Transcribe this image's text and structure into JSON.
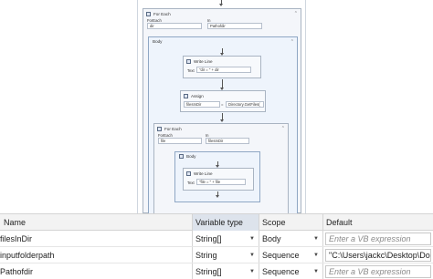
{
  "designer": {
    "outer_foreach": {
      "title": "For Each",
      "foreach_label": "ForEach",
      "in_label": "In",
      "item_value": "dir",
      "collection_value": "Pathofdir",
      "body": {
        "title": "Body",
        "writeline1": {
          "title": "Write Line",
          "text_label": "Text",
          "text_value": "\"dir = \" + dir"
        },
        "assign": {
          "title": "Assign",
          "to_value": "filesInDir",
          "value": "Directory.GetFiles("
        },
        "inner_foreach": {
          "title": "For Each",
          "foreach_label": "ForEach",
          "in_label": "In",
          "item_value": "file",
          "collection_value": "filesInDir",
          "body": {
            "title": "Body",
            "writeline2": {
              "title": "Write Line",
              "text_label": "Text",
              "text_value": "\"file = \" + file"
            }
          }
        }
      }
    }
  },
  "variables": {
    "headers": [
      "Name",
      "Variable type",
      "Scope",
      "Default"
    ],
    "rows": [
      {
        "name": "filesInDir",
        "type": "String[]",
        "scope": "Body",
        "default": "Enter a VB expression",
        "default_is_placeholder": true
      },
      {
        "name": "inputfolderpath",
        "type": "String",
        "scope": "Sequence",
        "default": "\"C:\\Users\\jackc\\Desktop\\Docs\"",
        "default_is_placeholder": false
      },
      {
        "name": "Pathofdir",
        "type": "String[]",
        "scope": "Sequence",
        "default": "Enter a VB expression",
        "default_is_placeholder": true
      }
    ]
  }
}
